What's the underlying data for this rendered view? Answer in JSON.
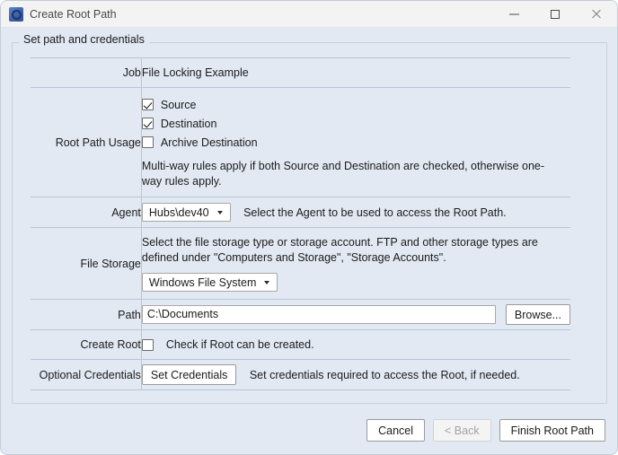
{
  "window": {
    "title": "Create Root Path",
    "icon": "app-ring-icon",
    "controls": {
      "minimize": "minimize-icon",
      "maximize": "maximize-icon",
      "close": "close-icon"
    }
  },
  "group": {
    "legend": "Set path and credentials"
  },
  "form": {
    "job": {
      "label": "Job",
      "value": "File Locking Example"
    },
    "root_path_usage": {
      "label": "Root Path Usage",
      "checkboxes": [
        {
          "label": "Source",
          "checked": true
        },
        {
          "label": "Destination",
          "checked": true
        },
        {
          "label": "Archive Destination",
          "checked": false
        }
      ],
      "help": "Multi-way rules apply if both Source and Destination are checked, otherwise one-way rules apply."
    },
    "agent": {
      "label": "Agent",
      "selected": "Hubs\\dev40",
      "description": "Select the Agent to be used to access the Root Path."
    },
    "file_storage": {
      "label": "File Storage",
      "help": "Select the file storage type or storage account. FTP and other storage types are defined under \"Computers and Storage\", \"Storage Accounts\".",
      "selected": "Windows File System"
    },
    "path": {
      "label": "Path",
      "value": "C:\\Documents",
      "browse_label": "Browse..."
    },
    "create_root": {
      "label": "Create Root",
      "checkbox": {
        "label": "Check if Root can be created.",
        "checked": false
      }
    },
    "optional_credentials": {
      "label": "Optional Credentials",
      "button_label": "Set Credentials",
      "description": "Set credentials required to access the Root, if needed."
    }
  },
  "footer": {
    "cancel": "Cancel",
    "back": "< Back",
    "finish": "Finish Root Path"
  }
}
